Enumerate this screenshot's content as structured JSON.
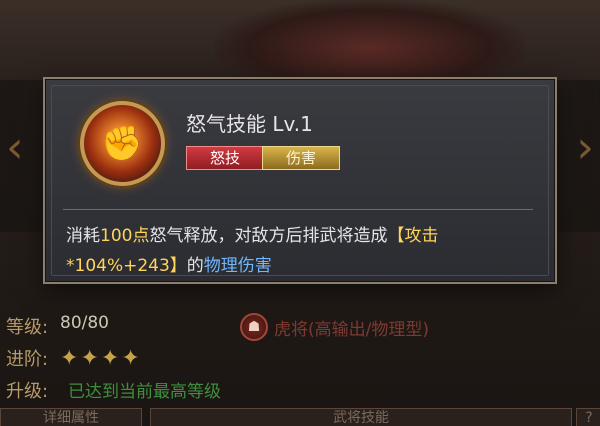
{
  "skill": {
    "name": "怒气技能 Lv.1",
    "tags": [
      "怒技",
      "伤害"
    ],
    "desc_prefix": "消耗",
    "desc_cost": "100点",
    "desc_mid": "怒气释放，对敌方后排武将造成",
    "desc_bonus": "【攻击*104%+243】",
    "desc_of": "的",
    "desc_damage": "物理伤害"
  },
  "stats": {
    "level_label": "等级:",
    "level_value": "80/80",
    "advance_label": "进阶:",
    "advance_stars": 4,
    "upgrade_label": "升级:",
    "upgrade_value": "已达到当前最高等级",
    "type_text": "虎将(高输出/物理型)"
  },
  "tabs": {
    "left": "详细属性",
    "mid": "武将技能",
    "right": "?"
  },
  "icons": [
    "skill-fist-icon",
    "star-icon",
    "type-badge-icon",
    "chevron-left-icon",
    "chevron-right-icon"
  ]
}
